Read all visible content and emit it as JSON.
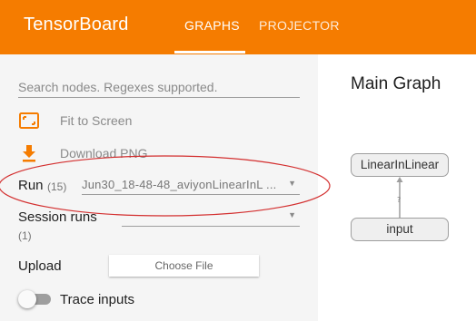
{
  "header": {
    "app_title": "TensorBoard",
    "tabs": [
      {
        "label": "GRAPHS",
        "active": true
      },
      {
        "label": "PROJECTOR",
        "active": false
      }
    ],
    "accent_color": "#f57c00"
  },
  "sidebar": {
    "search": {
      "placeholder": "Search nodes. Regexes supported.",
      "value": ""
    },
    "fit_to_screen": {
      "label": "Fit to Screen",
      "icon": "fit-screen-icon"
    },
    "download_png": {
      "label": "Download PNG",
      "icon": "download-icon"
    },
    "run": {
      "label": "Run",
      "count": "(15)",
      "selected": "Jun30_18-48-48_aviyonLinearInL ..."
    },
    "session_runs": {
      "label": "Session runs",
      "count": "(1)",
      "selected": ""
    },
    "upload": {
      "label": "Upload",
      "button_label": "Choose File"
    },
    "trace_inputs": {
      "label": "Trace inputs",
      "enabled": false
    }
  },
  "main": {
    "title": "Main Graph",
    "nodes": [
      {
        "label": "LinearInLinear"
      },
      {
        "label": "input"
      }
    ],
    "edge_label": "?"
  },
  "annotation": {
    "color": "#d32f2f"
  }
}
